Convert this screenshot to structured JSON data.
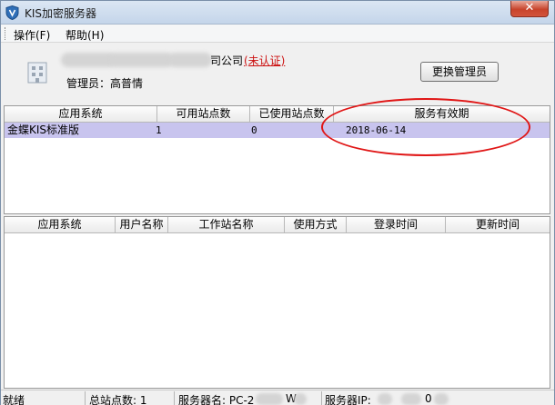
{
  "window": {
    "title": "KIS加密服务器",
    "close_glyph": "✕"
  },
  "menu": {
    "items": [
      {
        "label": "操作(F)"
      },
      {
        "label": "帮助(H)"
      }
    ]
  },
  "header": {
    "company_suffix": "司公司",
    "cert_status": "(未认证)",
    "admin_line": "管理员：高普情",
    "change_admin_button": "更换管理员"
  },
  "license_table": {
    "columns": [
      "应用系统",
      "可用站点数",
      "已使用站点数",
      "服务有效期"
    ],
    "rows": [
      {
        "system": "金蝶KIS标准版",
        "available": "1",
        "used": "0",
        "expiry": "2018-06-14"
      }
    ]
  },
  "session_table": {
    "columns": [
      "应用系统",
      "用户名称",
      "工作站名称",
      "使用方式",
      "登录时间",
      "更新时间"
    ],
    "rows": []
  },
  "status": {
    "ready": "就绪",
    "total_sites": "总站点数: 1",
    "server_name": "服务器名: PC-2",
    "server_name_tail": "W",
    "server_ip": "服务器IP:",
    "server_ip_tail": "0"
  },
  "colors": {
    "selected_row": "#c8c4ee",
    "cert_warning": "#cc1010",
    "annotation": "#e01616"
  }
}
